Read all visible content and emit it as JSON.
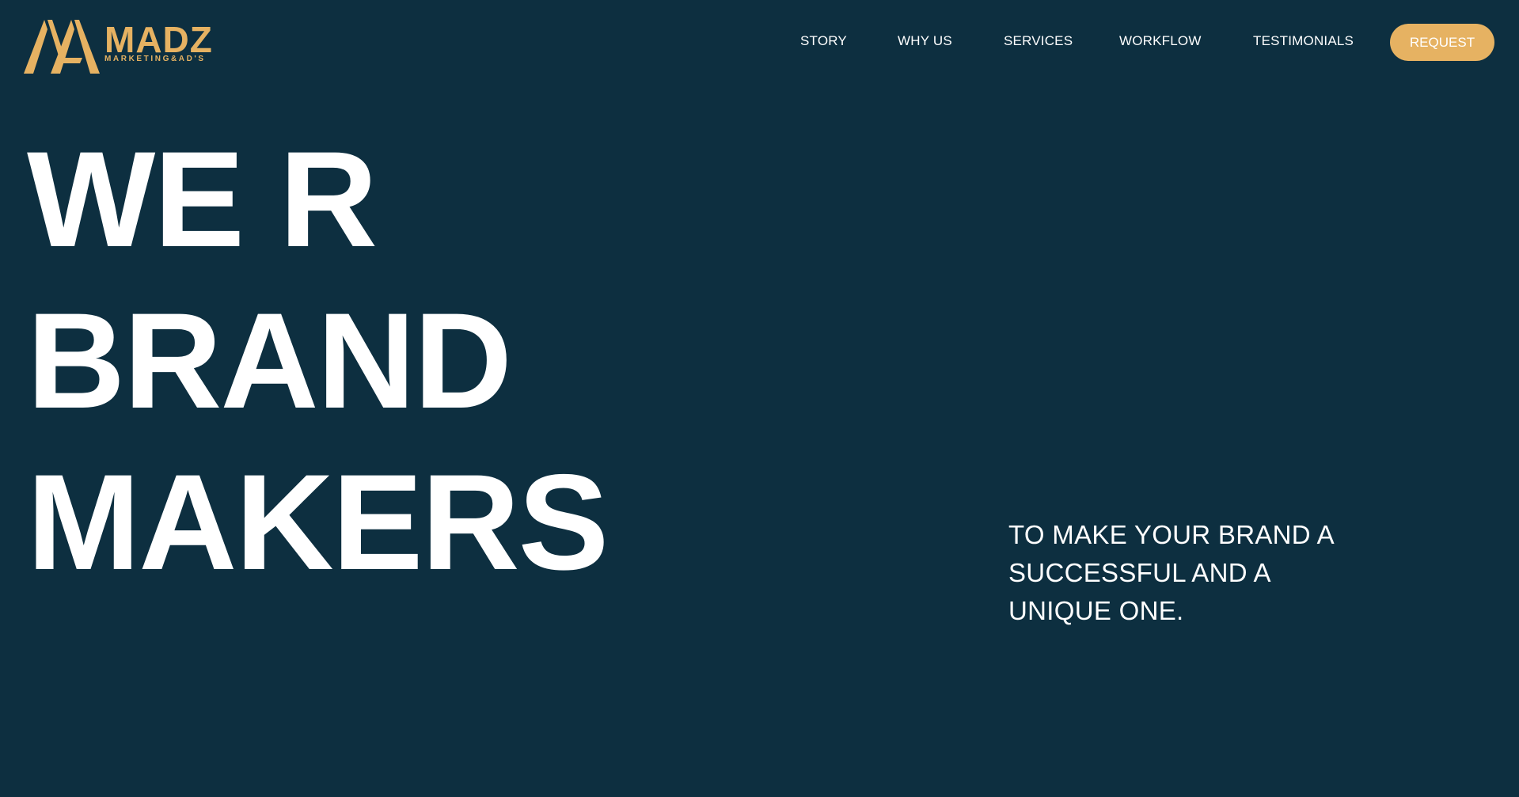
{
  "brand": {
    "name": "MADZ",
    "subtitle": "MARKETING&AD'S",
    "logo_icon": "ma-monogram-icon",
    "accent_color": "#e6b262",
    "background_color": "#0d2f40"
  },
  "nav": {
    "items": [
      {
        "label": "STORY"
      },
      {
        "label": "WHY US"
      },
      {
        "label": "SERVICES"
      },
      {
        "label": "WORKFLOW"
      },
      {
        "label": "TESTIMONIALS"
      }
    ],
    "cta_label": "REQUEST"
  },
  "hero": {
    "lines": [
      "WE R",
      "BRAND",
      "MAKERS"
    ],
    "tagline_lines": [
      "TO MAKE YOUR BRAND A",
      "SUCCESSFUL AND A",
      "UNIQUE ONE."
    ]
  }
}
